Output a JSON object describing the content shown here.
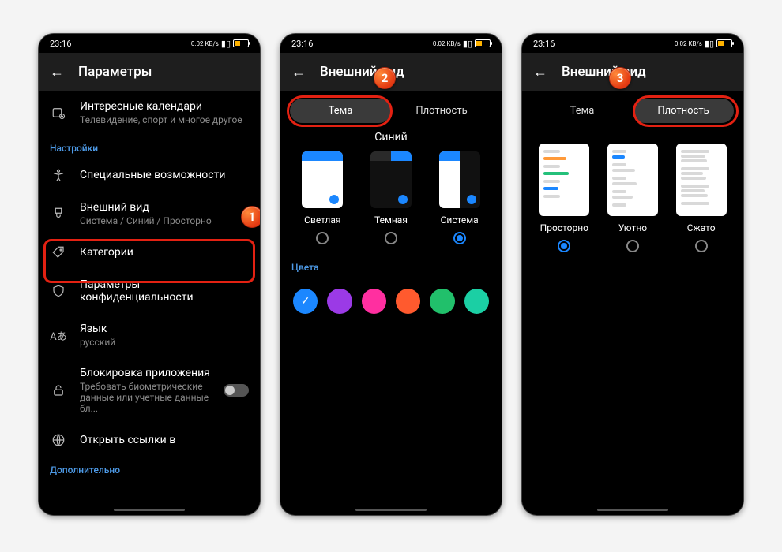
{
  "status": {
    "time": "23:16",
    "net": "0.02 KB/s"
  },
  "pane1": {
    "headerTitle": "Параметры",
    "interesting": {
      "title": "Интересные календари",
      "sub": "Телевидение, спорт и многое другое"
    },
    "sectionSettings": "Настройки",
    "access": "Специальные возможности",
    "appearance": {
      "title": "Внешний вид",
      "sub": "Система / Синий / Просторно"
    },
    "categories": "Категории",
    "privacy": "Параметры конфиденциальности",
    "language": {
      "title": "Язык",
      "sub": "русский"
    },
    "lock": {
      "title": "Блокировка приложения",
      "sub": "Требовать биометрические данные или учетные данные бл..."
    },
    "links": "Открыть ссылки в",
    "sectionMore": "Дополнительно",
    "badge": "1"
  },
  "pane2": {
    "headerTitle": "Внешний вид",
    "tabTheme": "Тема",
    "tabDensity": "Плотность",
    "themeColor": "Синий",
    "light": "Светлая",
    "dark": "Темная",
    "system": "Система",
    "colorsSection": "Цвета",
    "colors": [
      "#1b87ff",
      "#9b3ae6",
      "#ff2fa0",
      "#ff5a2e",
      "#21c06b",
      "#1bcfa4"
    ],
    "badge": "2"
  },
  "pane3": {
    "headerTitle": "Внешний вид",
    "tabTheme": "Тема",
    "tabDensity": "Плотность",
    "spacious": "Просторно",
    "cozy": "Уютно",
    "compact": "Сжато",
    "badge": "3"
  }
}
